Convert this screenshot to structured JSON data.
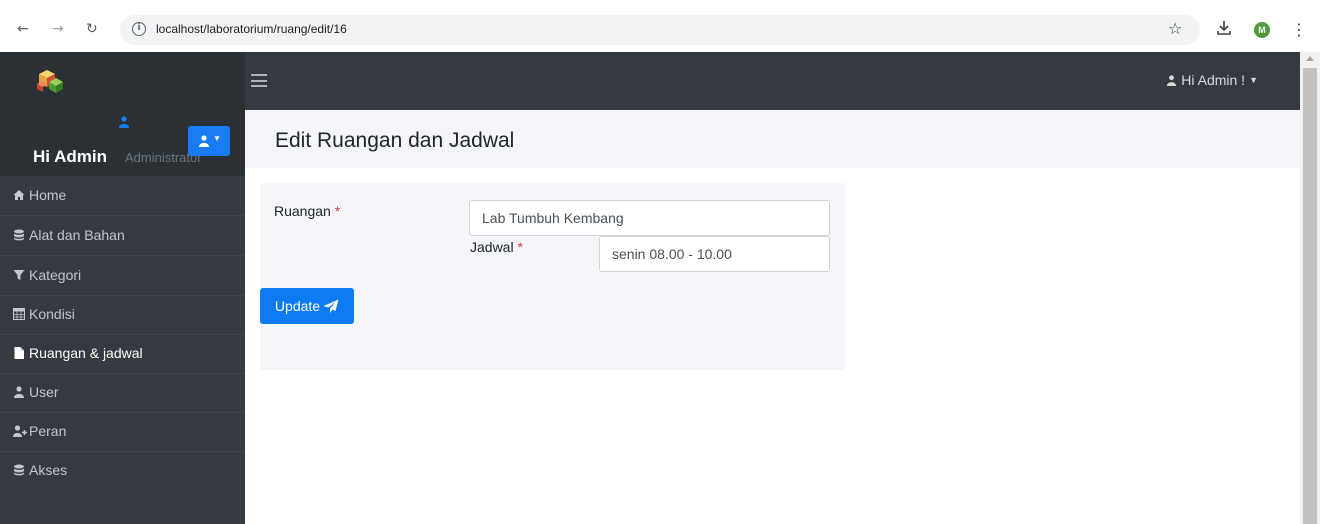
{
  "browser": {
    "url": "localhost/laboratorium/ruang/edit/16",
    "profile_initial": "M"
  },
  "navbar": {
    "greeting": "Hi Admin !"
  },
  "user_panel": {
    "name": "Hi Admin",
    "role": "Administrator"
  },
  "sidebar": {
    "items": [
      {
        "label": "Home",
        "icon": "home-icon",
        "active": false
      },
      {
        "label": "Alat dan Bahan",
        "icon": "database-icon",
        "active": false
      },
      {
        "label": "Kategori",
        "icon": "filter-icon",
        "active": false
      },
      {
        "label": "Kondisi",
        "icon": "table-icon",
        "active": false
      },
      {
        "label": "Ruangan & jadwal",
        "icon": "file-icon",
        "active": true
      },
      {
        "label": "User",
        "icon": "user-icon",
        "active": false
      },
      {
        "label": "Peran",
        "icon": "user-plus-icon",
        "active": false
      },
      {
        "label": "Akses",
        "icon": "database-icon",
        "active": false
      }
    ]
  },
  "page": {
    "title": "Edit Ruangan dan Jadwal"
  },
  "form": {
    "ruangan_label": "Ruangan",
    "ruangan_value": "Lab Tumbuh Kembang",
    "jadwal_label": "Jadwal",
    "jadwal_value": "senin 08.00 - 10.00",
    "required_marker": "*",
    "update_label": "Update"
  },
  "colors": {
    "primary": "#0d7bf2",
    "sidebar_bg": "#343a40",
    "required": "#dc3545"
  }
}
